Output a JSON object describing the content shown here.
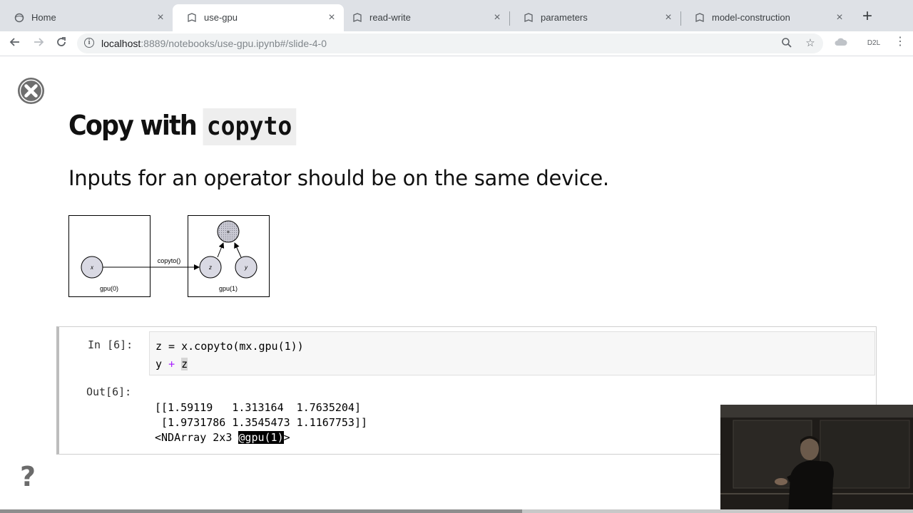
{
  "browser": {
    "tabs": [
      {
        "label": "Home",
        "active": false
      },
      {
        "label": "use-gpu",
        "active": true
      },
      {
        "label": "read-write",
        "active": false
      },
      {
        "label": "parameters",
        "active": false
      },
      {
        "label": "model-construction",
        "active": false
      }
    ],
    "url_host": "localhost",
    "url_rest": ":8889/notebooks/use-gpu.ipynb#/slide-4-0",
    "extension_label": "D2L"
  },
  "slide": {
    "title_text": "Copy with",
    "title_code": "copyto",
    "subtitle": "Inputs for an operator should be on the same device."
  },
  "diagram": {
    "left_box_label": "gpu(0)",
    "right_box_label": "gpu(1)",
    "arrow_label": "copyto()",
    "node_x": "x",
    "node_z": "z",
    "node_y": "y",
    "node_op": "+"
  },
  "cell": {
    "in_prompt": "In [6]:",
    "code_line1": "z = x.copyto(mx.gpu(1))",
    "code_line2_a": "y",
    "code_line2_op": "+",
    "code_line2_b": "z",
    "out_prompt": "Out[6]:",
    "output_line1": "[[1.59119   1.313164  1.7635204]",
    "output_line2": " [1.9731786 1.3545473 1.1167753]]",
    "output_line3_a": "<NDArray 2x3 ",
    "output_line3_sel": "@gpu(1)",
    "output_line3_b": ">"
  },
  "colors": {
    "tabstrip": "#dee1e6",
    "selection": "#000000",
    "node_fill": "#d9d9e3"
  }
}
